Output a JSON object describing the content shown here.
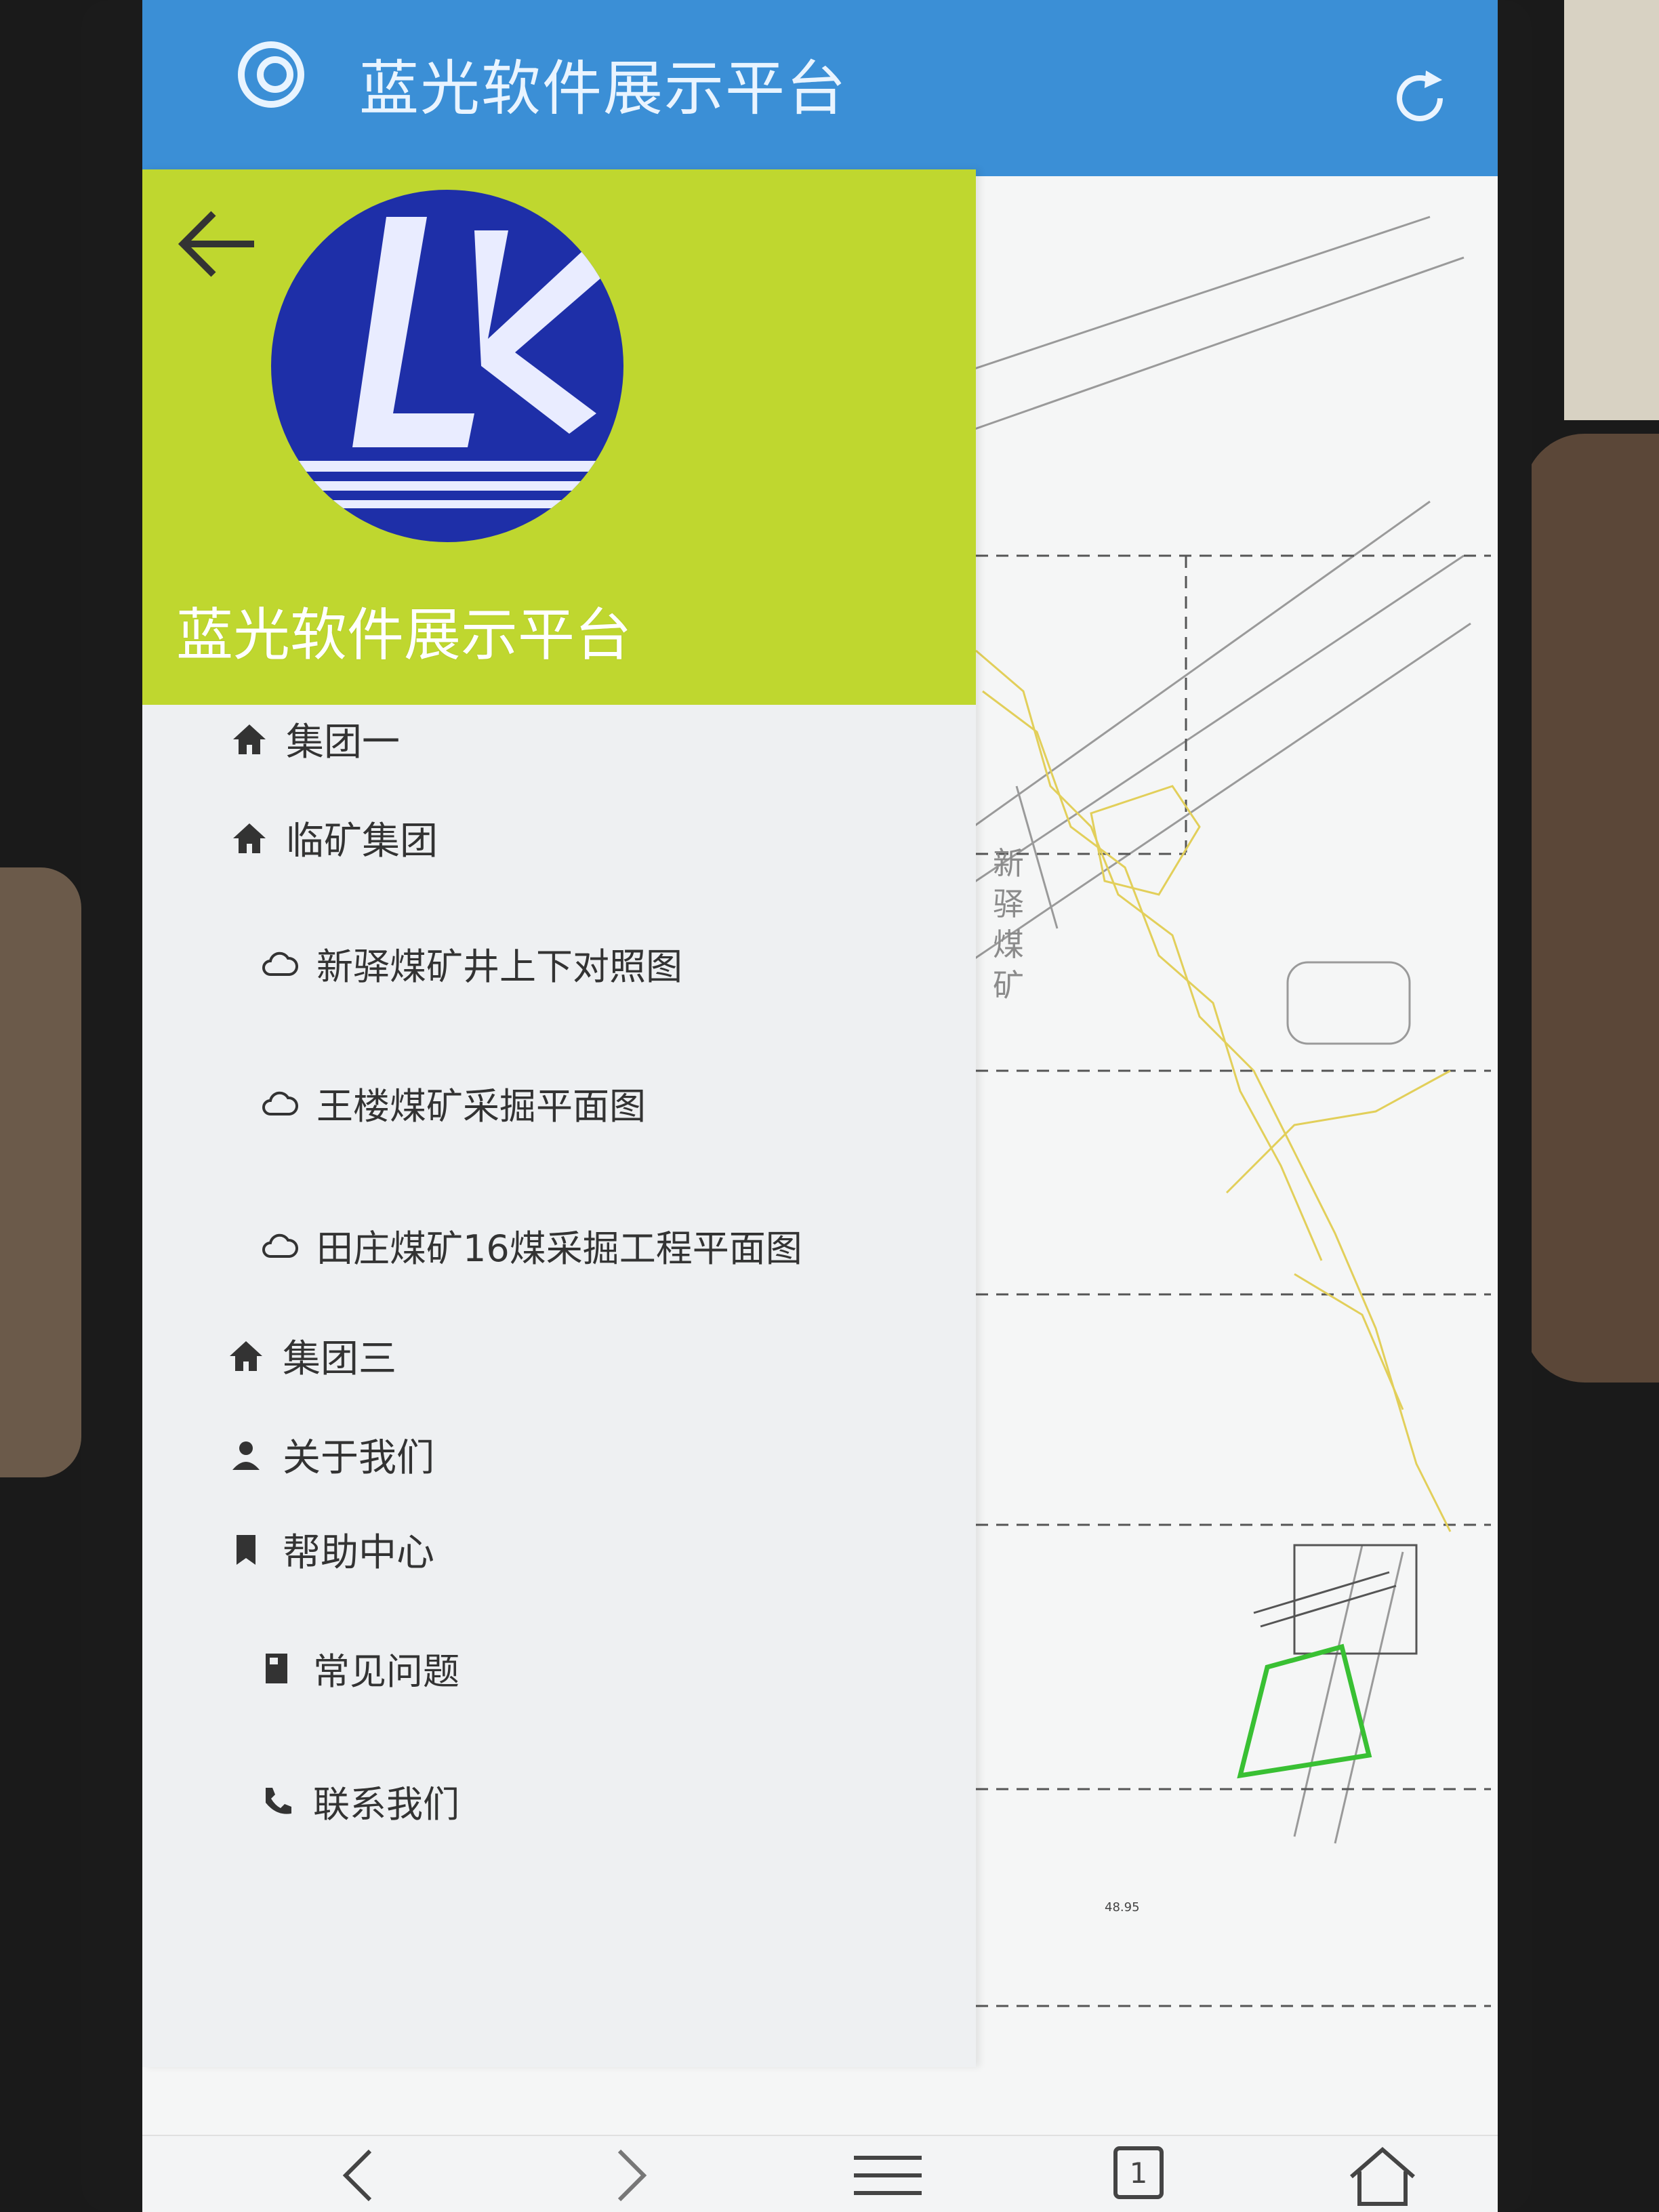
{
  "header": {
    "title": "蓝光软件展示平台"
  },
  "drawer": {
    "title": "蓝光软件展示平台",
    "logo_text": "LK",
    "items": [
      {
        "label": "集团一",
        "icon": "home-icon",
        "level": 0
      },
      {
        "label": "临矿集团",
        "icon": "home-icon",
        "level": 0
      },
      {
        "label": "新驿煤矿井上下对照图",
        "icon": "cloud-icon",
        "level": 1
      },
      {
        "label": "王楼煤矿采掘平面图",
        "icon": "cloud-icon",
        "level": 1
      },
      {
        "label": "田庄煤矿16煤采掘工程平面图",
        "icon": "cloud-icon",
        "level": 1
      },
      {
        "label": "集团三",
        "icon": "home-icon",
        "level": 0
      },
      {
        "label": "关于我们",
        "icon": "user-icon",
        "level": 0
      },
      {
        "label": "帮助中心",
        "icon": "bookmark-icon",
        "level": 0
      },
      {
        "label": "常见问题",
        "icon": "book-icon",
        "level": 1
      },
      {
        "label": "联系我们",
        "icon": "phone-icon",
        "level": 1
      }
    ]
  },
  "map": {
    "label_vertical": "新驿煤矿",
    "small_number": "48.95"
  },
  "bottom_nav": {
    "tab_count": "1",
    "icons": [
      "back-icon",
      "forward-icon",
      "menu-icon",
      "tabs-icon",
      "home-icon"
    ]
  },
  "colors": {
    "appbar": "#3b8fd6",
    "drawer_header": "#bfd72f",
    "logo_blue": "#1e2fa8"
  }
}
